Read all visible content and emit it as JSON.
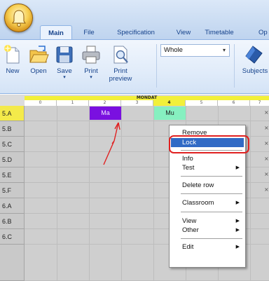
{
  "ribbon": {
    "tabs": [
      {
        "label": "Main",
        "active": true
      },
      {
        "label": "File",
        "active": false
      },
      {
        "label": "Specification",
        "active": false
      },
      {
        "label": "View",
        "active": false
      },
      {
        "label": "Timetable",
        "active": false
      },
      {
        "label": "Op",
        "active": false
      }
    ],
    "buttons": {
      "new": "New",
      "open": "Open",
      "save": "Save",
      "print": "Print",
      "print_preview_line1": "Print",
      "print_preview_line2": "preview",
      "subjects": "Subjects"
    },
    "view_combo_value": "Whole"
  },
  "grid": {
    "day": "MONDAT",
    "periods": [
      "0",
      "1",
      "2",
      "3",
      "4",
      "5",
      "6",
      "7"
    ],
    "selected_period": "4",
    "rows": [
      "5.A",
      "5.B",
      "5.C",
      "5.D",
      "5.E",
      "5.F",
      "6.A",
      "6.B",
      "6.C"
    ],
    "selected_row": "5.A",
    "lessons": [
      {
        "row": "5.A",
        "period": "2",
        "text": "Ma",
        "color": "#7a10e0"
      },
      {
        "row": "5.A",
        "period": "4",
        "text": "Mu",
        "color": "#86f0c0"
      }
    ],
    "row_markers": [
      "×",
      "×",
      "×",
      "×",
      "×",
      "×"
    ]
  },
  "context_menu": {
    "items": [
      {
        "label": "Remove"
      },
      {
        "label": "Lock",
        "highlighted": true
      },
      {
        "label": "Info"
      },
      {
        "label": "Test",
        "submenu": true
      },
      {
        "label": "Delete row"
      },
      {
        "label": "Classroom",
        "submenu": true
      },
      {
        "label": "View",
        "submenu": true
      },
      {
        "label": "Other",
        "submenu": true
      },
      {
        "label": "Edit",
        "submenu": true
      }
    ],
    "submenu_arrow": "▶"
  },
  "colors": {
    "highlight": "#316ac5",
    "annotation": "#e02020",
    "selected_header": "#f2f03a"
  }
}
